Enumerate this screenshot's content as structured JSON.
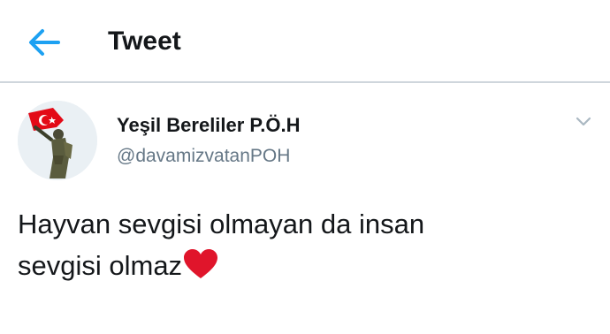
{
  "header": {
    "title": "Tweet",
    "back_icon": "arrow-left-icon",
    "accent_color": "#1da1f2"
  },
  "tweet": {
    "display_name": "Yeşil Bereliler P.Ö.H",
    "handle": "@davamizvatanPOH",
    "text_line1": "Hayvan sevgisi olmayan da insan",
    "text_line2": "sevgisi olmaz",
    "emoji": "red-heart-icon",
    "menu_icon": "chevron-down-icon"
  }
}
